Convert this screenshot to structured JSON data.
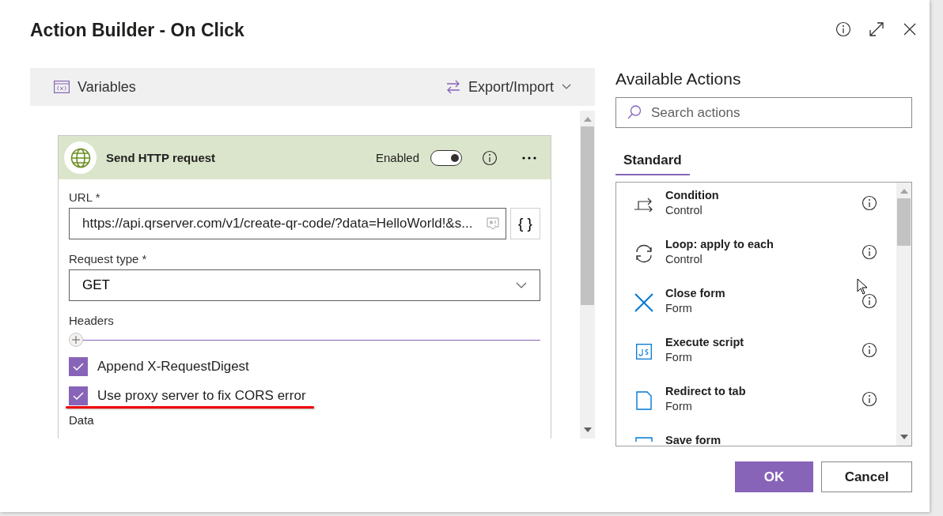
{
  "dialog": {
    "title": "Action Builder - On Click"
  },
  "toolbar": {
    "variables": "Variables",
    "export_import": "Export/Import"
  },
  "action_card": {
    "title": "Send HTTP request",
    "enabled_label": "Enabled",
    "enabled": true,
    "fields": [
      {
        "kind": "text",
        "label": "URL",
        "required_mark": "*",
        "value": "https://api.qrserver.com/v1/create-qr-code/?data=HelloWorld!&s...",
        "expression_button": "{ }"
      },
      {
        "kind": "select",
        "label": "Request type",
        "required_mark": "*",
        "value": "GET"
      }
    ],
    "headers_label": "Headers",
    "options": [
      {
        "label": "Append X-RequestDigest",
        "checked": true
      },
      {
        "label": "Use proxy server to fix CORS error",
        "checked": true,
        "underlined": true
      }
    ],
    "data_label": "Data"
  },
  "available_actions": {
    "title": "Available Actions",
    "search": {
      "placeholder": "Search actions"
    },
    "tabs": [
      {
        "label": "Standard",
        "selected": true
      }
    ],
    "actions": [
      {
        "kind": "condition",
        "name": "Condition",
        "category": "Control"
      },
      {
        "kind": "loop",
        "name": "Loop: apply to each",
        "category": "Control"
      },
      {
        "kind": "close",
        "name": "Close form",
        "category": "Form"
      },
      {
        "kind": "script",
        "name": "Execute script",
        "category": "Form"
      },
      {
        "kind": "redirect",
        "name": "Redirect to tab",
        "category": "Form"
      },
      {
        "kind": "save",
        "name": "Save form"
      }
    ]
  },
  "buttons": [
    {
      "kind": "primary",
      "label": "OK"
    },
    {
      "kind": "secondary",
      "label": "Cancel"
    }
  ]
}
